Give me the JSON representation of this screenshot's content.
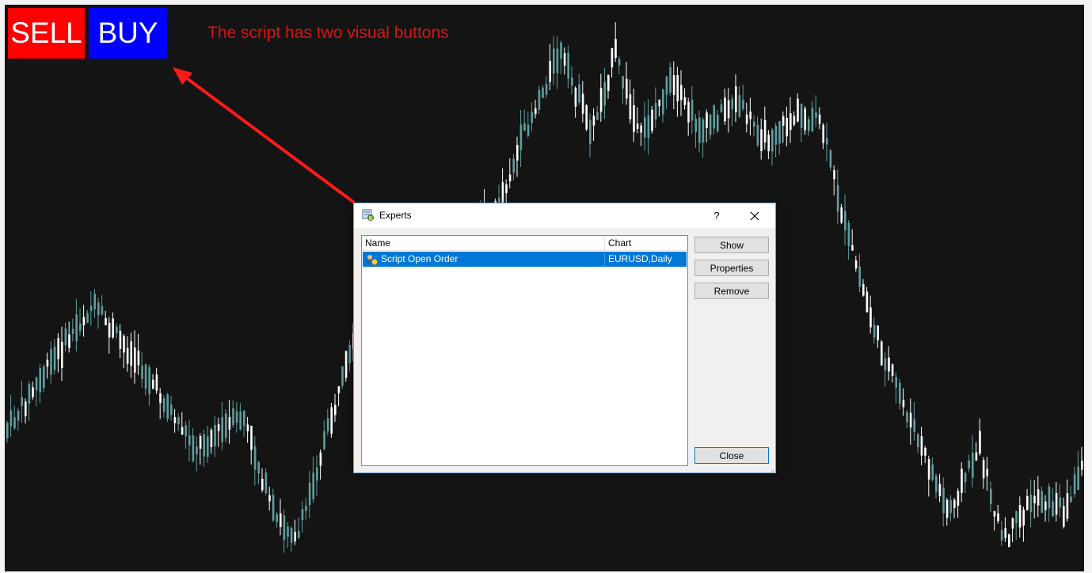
{
  "trade_buttons": {
    "sell_label": "SELL",
    "buy_label": "BUY",
    "sell_color": "#ff0000",
    "buy_color": "#0000ff"
  },
  "annotation": {
    "text": "The script has two visual buttons",
    "color": "#e01010"
  },
  "chart": {
    "background": "#141414",
    "bull_color": "#ffffff",
    "bear_color": "#5f9ea0"
  },
  "dialog": {
    "title": "Experts",
    "title_icon": "experts-icon",
    "help_label": "?",
    "close_icon": "close-icon",
    "columns": [
      "Name",
      "Chart"
    ],
    "rows": [
      {
        "name": "Script Open Order",
        "chart": "EURUSD,Daily",
        "icon": "script-icon",
        "selected": true
      }
    ],
    "buttons": {
      "show": "Show",
      "properties": "Properties",
      "remove": "Remove",
      "close": "Close"
    }
  }
}
